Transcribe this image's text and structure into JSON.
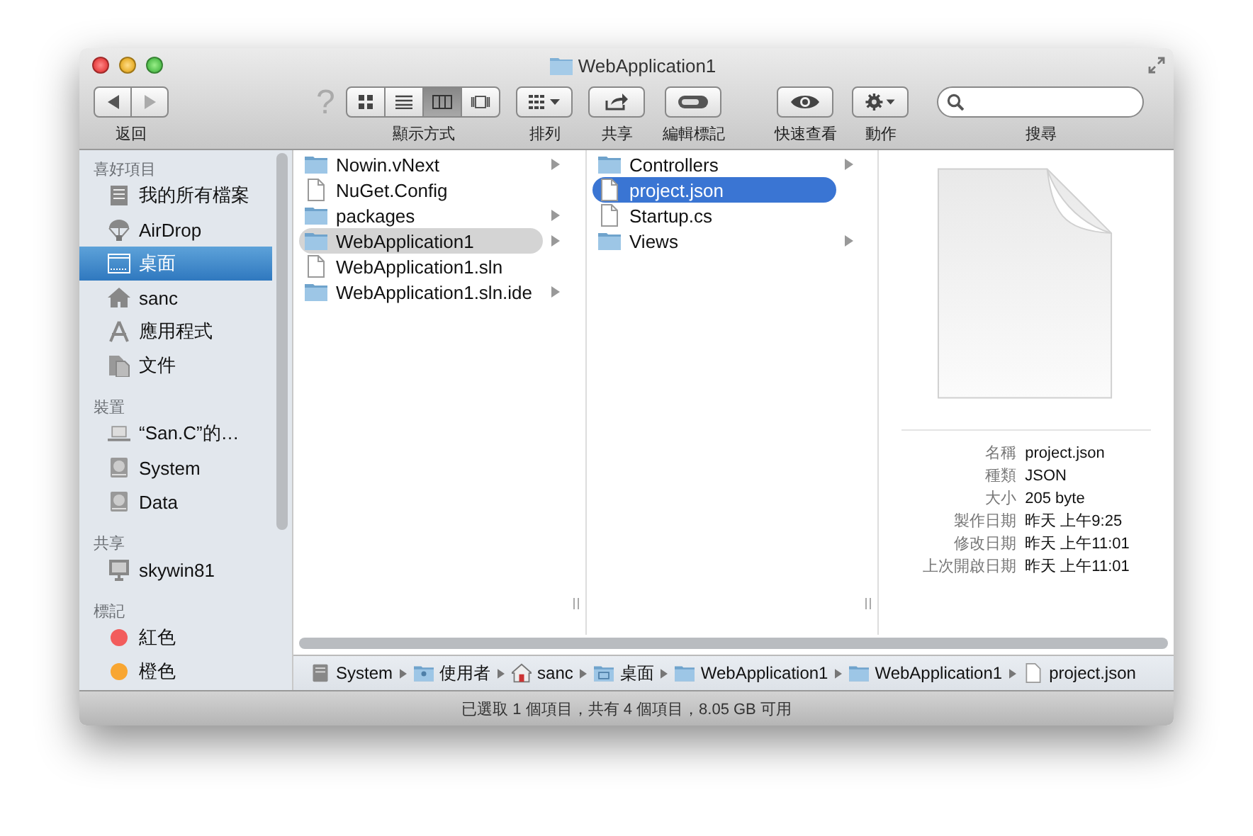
{
  "window": {
    "title": "WebApplication1"
  },
  "toolbar": [
    {
      "kind": "nav",
      "label": "返回"
    },
    {
      "kind": "help",
      "glyph": "?"
    },
    {
      "kind": "view",
      "label": "顯示方式",
      "segments": [
        {
          "kind": "icons",
          "selected": false
        },
        {
          "kind": "list",
          "selected": false
        },
        {
          "kind": "columns",
          "selected": true
        },
        {
          "kind": "coverflow",
          "selected": false
        }
      ]
    },
    {
      "kind": "arrange",
      "label": "排列"
    },
    {
      "kind": "share",
      "label": "共享"
    },
    {
      "kind": "tags",
      "label": "編輯標記"
    },
    {
      "kind": "quicklook",
      "label": "快速查看"
    },
    {
      "kind": "action",
      "label": "動作"
    },
    {
      "kind": "search",
      "label": "搜尋"
    }
  ],
  "sidebar": {
    "sections": [
      {
        "title": "喜好項目",
        "items": [
          {
            "label": "我的所有檔案",
            "kind": "allfiles",
            "selected": false
          },
          {
            "label": "AirDrop",
            "kind": "airdrop",
            "selected": false
          },
          {
            "label": "桌面",
            "kind": "desktop",
            "selected": true
          },
          {
            "label": "sanc",
            "kind": "home",
            "selected": false
          },
          {
            "label": "應用程式",
            "kind": "apps",
            "selected": false
          },
          {
            "label": "文件",
            "kind": "documents",
            "selected": false
          }
        ]
      },
      {
        "title": "裝置",
        "items": [
          {
            "label": "“San.C”的…",
            "kind": "laptop",
            "selected": false
          },
          {
            "label": "System",
            "kind": "disk",
            "selected": false
          },
          {
            "label": "Data",
            "kind": "disk",
            "selected": false
          }
        ]
      },
      {
        "title": "共享",
        "items": [
          {
            "label": "skywin81",
            "kind": "server",
            "selected": false
          }
        ]
      },
      {
        "title": "標記",
        "items": [
          {
            "label": "紅色",
            "kind": "tag",
            "color": "#f25c5c",
            "selected": false
          },
          {
            "label": "橙色",
            "kind": "tag",
            "color": "#f8a632",
            "selected": false
          }
        ]
      }
    ]
  },
  "columns": [
    {
      "focused": false,
      "items": [
        {
          "name": "Nowin.vNext",
          "kind": "folder",
          "selected": false
        },
        {
          "name": "NuGet.Config",
          "kind": "file",
          "selected": false
        },
        {
          "name": "packages",
          "kind": "folder",
          "selected": false
        },
        {
          "name": "WebApplication1",
          "kind": "folder",
          "selected": true
        },
        {
          "name": "WebApplication1.sln",
          "kind": "file",
          "selected": false
        },
        {
          "name": "WebApplication1.sln.ide",
          "kind": "folder",
          "selected": false
        }
      ]
    },
    {
      "focused": true,
      "items": [
        {
          "name": "Controllers",
          "kind": "folder",
          "selected": false
        },
        {
          "name": "project.json",
          "kind": "file",
          "selected": true
        },
        {
          "name": "Startup.cs",
          "kind": "file",
          "selected": false
        },
        {
          "name": "Views",
          "kind": "folder",
          "selected": false
        }
      ]
    }
  ],
  "preview": {
    "info": [
      {
        "label": "名稱",
        "value": "project.json"
      },
      {
        "label": "種類",
        "value": "JSON"
      },
      {
        "label": "大小",
        "value": "205 byte"
      },
      {
        "label": "製作日期",
        "value": "昨天 上午9:25"
      },
      {
        "label": "修改日期",
        "value": "昨天 上午11:01"
      },
      {
        "label": "上次開啟日期",
        "value": "昨天 上午11:01"
      }
    ]
  },
  "path_bar": [
    {
      "label": "System",
      "kind": "disk"
    },
    {
      "label": "使用者",
      "kind": "userfolder"
    },
    {
      "label": "sanc",
      "kind": "home"
    },
    {
      "label": "桌面",
      "kind": "desktopfolder"
    },
    {
      "label": "WebApplication1",
      "kind": "folder"
    },
    {
      "label": "WebApplication1",
      "kind": "folder"
    },
    {
      "label": "project.json",
      "kind": "file"
    }
  ],
  "status_bar": {
    "text": "已選取 1 個項目，共有 4 個項目，8.05 GB 可用"
  }
}
